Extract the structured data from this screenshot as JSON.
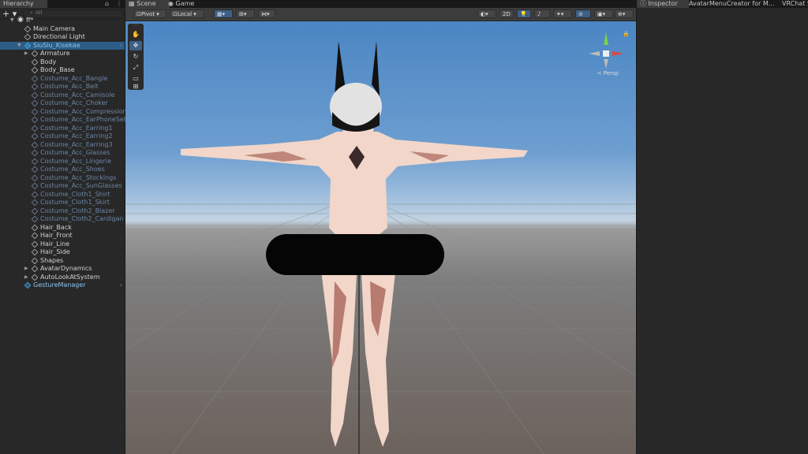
{
  "hierarchy": {
    "tab_label": "Hierarchy",
    "add_label": "+ ▾",
    "search_placeholder": "All",
    "rows": [
      {
        "label": "ff*",
        "depth": 0,
        "type": "scene"
      },
      {
        "label": "Main Camera",
        "depth": 1,
        "type": "obj"
      },
      {
        "label": "Directional Light",
        "depth": 1,
        "type": "obj"
      },
      {
        "label": "SiuSiu_Kisekae",
        "depth": 1,
        "type": "prefab",
        "selected": true
      },
      {
        "label": "Armature",
        "depth": 2,
        "type": "obj",
        "fold": true
      },
      {
        "label": "Body",
        "depth": 2,
        "type": "obj"
      },
      {
        "label": "Body_Base",
        "depth": 2,
        "type": "obj"
      },
      {
        "label": "Costume_Acc_Bangle",
        "depth": 2,
        "type": "dim"
      },
      {
        "label": "Costume_Acc_Belt",
        "depth": 2,
        "type": "dim"
      },
      {
        "label": "Costume_Acc_Camisole",
        "depth": 2,
        "type": "dim"
      },
      {
        "label": "Costume_Acc_Choker",
        "depth": 2,
        "type": "dim"
      },
      {
        "label": "Costume_Acc_Compression",
        "depth": 2,
        "type": "dim"
      },
      {
        "label": "Costume_Acc_EarPhoneSet",
        "depth": 2,
        "type": "dim"
      },
      {
        "label": "Costume_Acc_Earring1",
        "depth": 2,
        "type": "dim"
      },
      {
        "label": "Costume_Acc_Earring2",
        "depth": 2,
        "type": "dim"
      },
      {
        "label": "Costume_Acc_Earring3",
        "depth": 2,
        "type": "dim"
      },
      {
        "label": "Costume_Acc_Glasses",
        "depth": 2,
        "type": "dim"
      },
      {
        "label": "Costume_Acc_Lingerie",
        "depth": 2,
        "type": "dim"
      },
      {
        "label": "Costume_Acc_Shoes",
        "depth": 2,
        "type": "dim"
      },
      {
        "label": "Costume_Acc_Stockings",
        "depth": 2,
        "type": "dim"
      },
      {
        "label": "Costume_Acc_SunGlasses",
        "depth": 2,
        "type": "dim"
      },
      {
        "label": "Costume_Cloth1_Shirt",
        "depth": 2,
        "type": "dim"
      },
      {
        "label": "Costume_Cloth1_Skirt",
        "depth": 2,
        "type": "dim"
      },
      {
        "label": "Costume_Cloth2_Blazer",
        "depth": 2,
        "type": "dim"
      },
      {
        "label": "Costume_Cloth2_Cardigan",
        "depth": 2,
        "type": "dim"
      },
      {
        "label": "Hair_Back",
        "depth": 2,
        "type": "obj"
      },
      {
        "label": "Hair_Front",
        "depth": 2,
        "type": "obj"
      },
      {
        "label": "Hair_Line",
        "depth": 2,
        "type": "obj"
      },
      {
        "label": "Hair_Side",
        "depth": 2,
        "type": "obj"
      },
      {
        "label": "Shapes",
        "depth": 2,
        "type": "obj"
      },
      {
        "label": "AvatarDynamics",
        "depth": 2,
        "type": "obj",
        "fold": true
      },
      {
        "label": "AutoLookAtSystem",
        "depth": 2,
        "type": "obj",
        "fold": true
      },
      {
        "label": "GestureManager",
        "depth": 1,
        "type": "prefab",
        "more": true
      }
    ]
  },
  "scene": {
    "tab_scene": "Scene",
    "tab_game": "Game",
    "pivot_label": "Pivot",
    "local_label": "Local",
    "mode_2d": "2D",
    "persp_label": "< Persp",
    "colors": {
      "skin": "#f2d6c9",
      "shade": "#a9645a",
      "hair": "#e2e2e2",
      "ears": "#111111"
    }
  },
  "inspector": {
    "tabs": [
      "Inspector",
      "AvatarMenuCreator for M...",
      "VRChat S"
    ]
  }
}
